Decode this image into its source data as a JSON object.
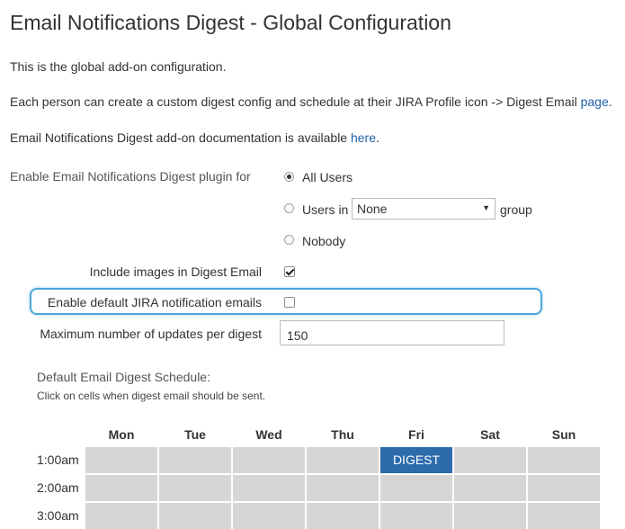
{
  "page": {
    "title": "Email Notifications Digest - Global Configuration",
    "intro": "This is the global add-on configuration.",
    "profile_text": "Each person can create a custom digest config and schedule at their JIRA Profile icon -> Digest Email ",
    "profile_link": "page",
    "profile_end": ".",
    "docs_text": "Email Notifications Digest add-on documentation is available ",
    "docs_link": "here",
    "docs_end": "."
  },
  "form": {
    "enable_label": "Enable Email Notifications Digest plugin for",
    "options": {
      "all_users": "All Users",
      "users_in": "Users in",
      "group_suffix": "group",
      "nobody": "Nobody"
    },
    "selected_option": "All Users",
    "group_select_value": "None",
    "include_images_label": "Include images in Digest Email",
    "include_images_checked": true,
    "default_jira_label": "Enable default JIRA notification emails",
    "default_jira_checked": false,
    "max_updates_label": "Maximum number of updates per digest",
    "max_updates_value": "150"
  },
  "schedule": {
    "title": "Default Email Digest Schedule:",
    "hint": "Click on cells when digest email should be sent.",
    "days": [
      "Mon",
      "Tue",
      "Wed",
      "Thu",
      "Fri",
      "Sat",
      "Sun"
    ],
    "rows": [
      {
        "time": "1:00am",
        "cells": [
          "",
          "",
          "",
          "",
          "DIGEST",
          "",
          ""
        ]
      },
      {
        "time": "2:00am",
        "cells": [
          "",
          "",
          "",
          "",
          "",
          "",
          ""
        ]
      },
      {
        "time": "3:00am",
        "cells": [
          "",
          "",
          "",
          "",
          "",
          "",
          ""
        ]
      }
    ],
    "active_color": "#2d6bab",
    "inactive_color": "#d6d6d6"
  },
  "icons": {
    "select_arrow": "dropdown-arrow-icon"
  }
}
